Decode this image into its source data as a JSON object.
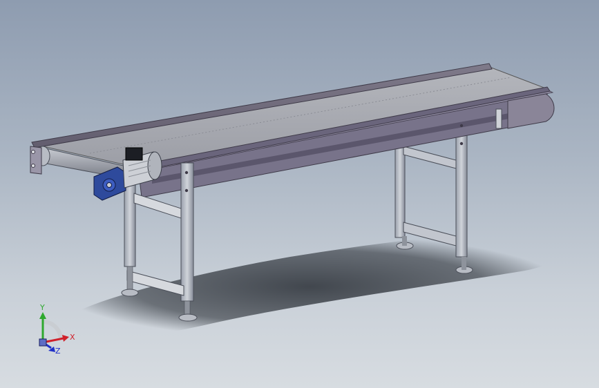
{
  "view": {
    "background_top": "#8e9cb0",
    "background_bottom": "#d7dce1"
  },
  "model": {
    "object": "belt-conveyor",
    "visible_parts": [
      "belt",
      "side-frame",
      "drive-motor",
      "worm-gearbox",
      "tail-pulley",
      "support-legs",
      "cross-braces",
      "leveling-feet"
    ]
  },
  "triad": {
    "x_label": "X",
    "y_label": "Y",
    "z_label": "Z",
    "x_color": "#d0202a",
    "y_color": "#2ea82e",
    "z_color": "#2030c8"
  }
}
